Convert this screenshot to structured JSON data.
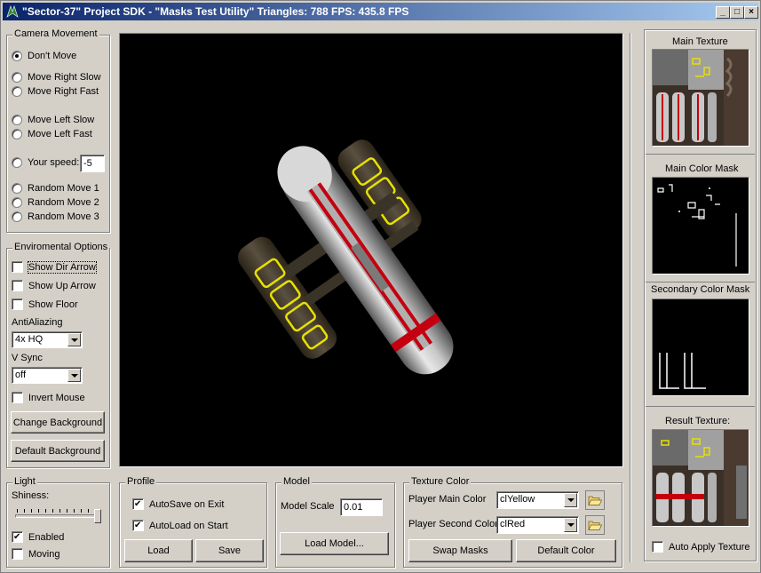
{
  "window": {
    "title": "\"Sector-37\" Project SDK - \"Masks Test Utility\"   Triangles:  788   FPS:  435.8 FPS",
    "min_glyph": "_",
    "max_glyph": "□",
    "close_glyph": "×"
  },
  "camera": {
    "title": "Camera Movement",
    "dont_move": "Don't Move",
    "right_slow": "Move Right Slow",
    "right_fast": "Move Right Fast",
    "left_slow": "Move Left Slow",
    "left_fast": "Move Left Fast",
    "your_speed": "Your speed:",
    "speed_value": "-5",
    "random1": "Random Move 1",
    "random2": "Random Move 2",
    "random3": "Random Move 3",
    "selected": "dont_move"
  },
  "env": {
    "title": "Enviromental Options",
    "show_dir_arrow": "Show Dir Arrow",
    "show_up_arrow": "Show Up Arrow",
    "show_floor": "Show Floor",
    "antialiasing_label": "AntiAliazing",
    "antialiasing_value": "4x HQ",
    "vsync_label": "V Sync",
    "vsync_value": "off",
    "invert_mouse": "Invert Mouse",
    "change_bg": "Change Background",
    "default_bg": "Default Background"
  },
  "light": {
    "title": "Light",
    "shiness": "Shiness:",
    "enabled": "Enabled",
    "moving": "Moving",
    "enabled_checked": true,
    "moving_checked": false
  },
  "profile": {
    "title": "Profile",
    "autosave": "AutoSave on Exit",
    "autoload": "AutoLoad on Start",
    "load": "Load",
    "save": "Save"
  },
  "model": {
    "title": "Model",
    "scale_label": "Model Scale",
    "scale_value": "0.01",
    "load_model": "Load Model..."
  },
  "texture_color": {
    "title": "Texture Color",
    "main_label": "Player Main Color",
    "main_value": "clYellow",
    "second_label": "Player Second Color",
    "second_value": "clRed",
    "swap_masks": "Swap Masks",
    "default_color": "Default Color"
  },
  "textures": {
    "main_texture": "Main Texture",
    "main_color_mask": "Main Color Mask",
    "secondary_color_mask": "Secondary Color Mask",
    "result_texture": "Result Texture:",
    "auto_apply": "Auto Apply Texture"
  },
  "colors": {
    "title_start": "#0a246a",
    "title_end": "#a6caf0",
    "face": "#d4d0c8",
    "hull_yellow": "#e8e000",
    "hull_red": "#c40010"
  }
}
